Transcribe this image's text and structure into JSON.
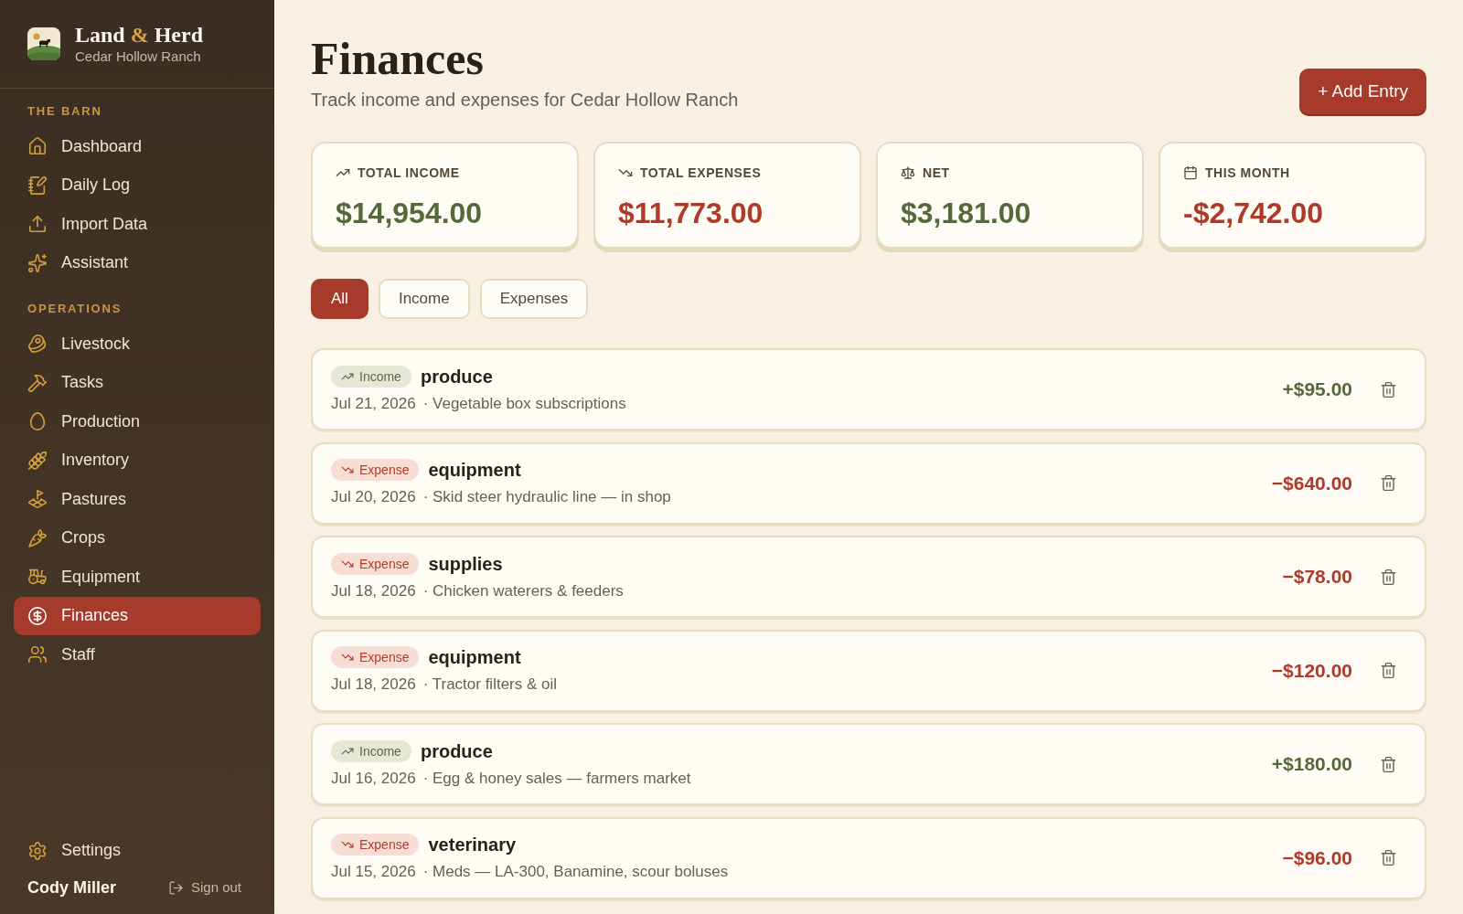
{
  "sidebar": {
    "brand": {
      "title_parts": [
        {
          "text": "Land",
          "accent": false
        },
        {
          "text": "&",
          "accent": true
        },
        {
          "text": "Herd",
          "accent": false
        }
      ],
      "subtitle": "Cedar Hollow Ranch"
    },
    "sections": [
      {
        "heading": "THE BARN",
        "items": [
          {
            "label": "Dashboard",
            "selected": false
          },
          {
            "label": "Daily Log",
            "selected": false
          },
          {
            "label": "Import Data",
            "selected": false
          },
          {
            "label": "Assistant",
            "selected": false
          }
        ]
      },
      {
        "heading": "OPERATIONS",
        "items": [
          {
            "label": "Livestock",
            "selected": false
          },
          {
            "label": "Tasks",
            "selected": false
          },
          {
            "label": "Production",
            "selected": false
          },
          {
            "label": "Inventory",
            "selected": false
          },
          {
            "label": "Pastures",
            "selected": false
          },
          {
            "label": "Crops",
            "selected": false
          },
          {
            "label": "Equipment",
            "selected": false
          },
          {
            "label": "Finances",
            "selected": true
          },
          {
            "label": "Staff",
            "selected": false
          }
        ]
      }
    ],
    "footer": {
      "settings": "Settings",
      "user_name": "Cody Miller",
      "sign_out": "Sign out"
    }
  },
  "header": {
    "title": "Finances",
    "subtitle": "Track income and expenses for Cedar Hollow Ranch",
    "add_button": "+ Add Entry"
  },
  "stats": [
    {
      "kind": "income",
      "label": "TOTAL INCOME",
      "value": "$14,954.00",
      "negative": false
    },
    {
      "kind": "expenses",
      "label": "TOTAL EXPENSES",
      "value": "$11,773.00",
      "negative": true
    },
    {
      "kind": "net",
      "label": "NET",
      "value": "$3,181.00",
      "negative": false
    },
    {
      "kind": "month",
      "label": "THIS MONTH",
      "value": "-$2,742.00",
      "negative": true
    }
  ],
  "filters": [
    {
      "label": "All",
      "selected": true
    },
    {
      "label": "Income",
      "selected": false
    },
    {
      "label": "Expenses",
      "selected": false
    }
  ],
  "entries": [
    {
      "kind": "income",
      "badge": "Income",
      "category": "produce",
      "date": "Jul 21, 2026",
      "description": "· Vegetable box subscriptions",
      "amount": "+$95.00"
    },
    {
      "kind": "expense",
      "badge": "Expense",
      "category": "equipment",
      "date": "Jul 20, 2026",
      "description": "· Skid steer hydraulic line — in shop",
      "amount": "−$640.00"
    },
    {
      "kind": "expense",
      "badge": "Expense",
      "category": "supplies",
      "date": "Jul 18, 2026",
      "description": "· Chicken waterers & feeders",
      "amount": "−$78.00"
    },
    {
      "kind": "expense",
      "badge": "Expense",
      "category": "equipment",
      "date": "Jul 18, 2026",
      "description": "· Tractor filters & oil",
      "amount": "−$120.00"
    },
    {
      "kind": "income",
      "badge": "Income",
      "category": "produce",
      "date": "Jul 16, 2026",
      "description": "· Egg & honey sales — farmers market",
      "amount": "+$180.00"
    },
    {
      "kind": "expense",
      "badge": "Expense",
      "category": "veterinary",
      "date": "Jul 15, 2026",
      "description": "· Meds — LA-300, Banamine, scour boluses",
      "amount": "−$96.00"
    }
  ]
}
